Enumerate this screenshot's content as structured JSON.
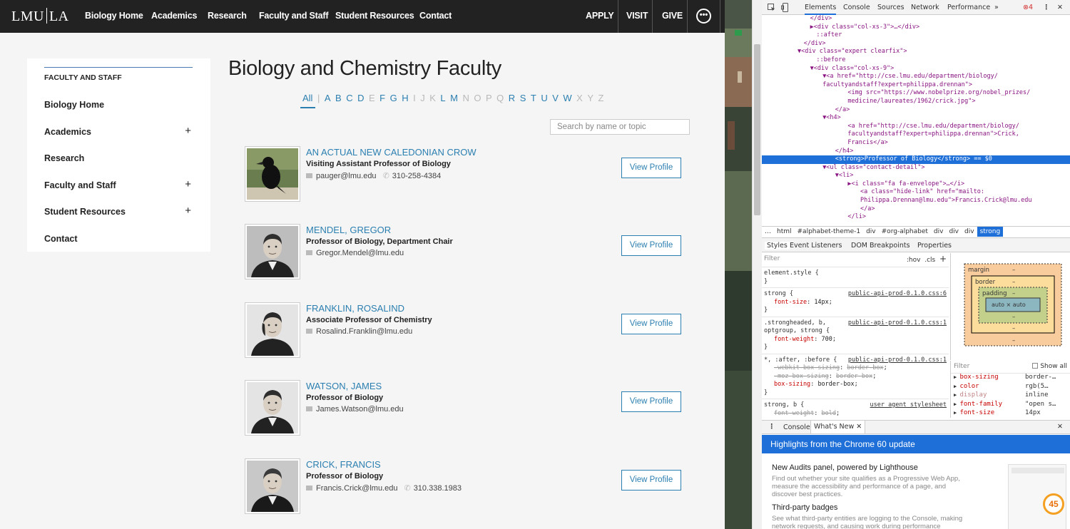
{
  "site": {
    "logo": {
      "left": "LMU",
      "right": "LA"
    },
    "nav": [
      "Biology Home",
      "Academics",
      "Research",
      "Faculty and Staff",
      "Student Resources",
      "Contact"
    ],
    "nav_right": [
      "APPLY",
      "VISIT",
      "GIVE"
    ],
    "more_icon": "ellipsis-circle-icon",
    "search_icon": "magnifier-icon",
    "sidebar": {
      "heading": "FACULTY AND STAFF",
      "items": [
        {
          "label": "Biology Home",
          "expandable": false
        },
        {
          "label": "Academics",
          "expandable": true
        },
        {
          "label": "Research",
          "expandable": false
        },
        {
          "label": "Faculty and Staff",
          "expandable": true
        },
        {
          "label": "Student Resources",
          "expandable": true
        },
        {
          "label": "Contact",
          "expandable": false
        }
      ],
      "plus": "+"
    },
    "page_title": "Biology and Chemistry Faculty",
    "alphabet": {
      "all": "All",
      "sep": "|",
      "letters": [
        {
          "l": "A",
          "a": true
        },
        {
          "l": "B",
          "a": true
        },
        {
          "l": "C",
          "a": true
        },
        {
          "l": "D",
          "a": true
        },
        {
          "l": "E",
          "a": false
        },
        {
          "l": "F",
          "a": true
        },
        {
          "l": "G",
          "a": true
        },
        {
          "l": "H",
          "a": true
        },
        {
          "l": "I",
          "a": false
        },
        {
          "l": "J",
          "a": false
        },
        {
          "l": "K",
          "a": false
        },
        {
          "l": "L",
          "a": true
        },
        {
          "l": "M",
          "a": true
        },
        {
          "l": "N",
          "a": false
        },
        {
          "l": "O",
          "a": false
        },
        {
          "l": "P",
          "a": false
        },
        {
          "l": "Q",
          "a": false
        },
        {
          "l": "R",
          "a": true
        },
        {
          "l": "S",
          "a": true
        },
        {
          "l": "T",
          "a": true
        },
        {
          "l": "U",
          "a": true
        },
        {
          "l": "V",
          "a": true
        },
        {
          "l": "W",
          "a": true
        },
        {
          "l": "X",
          "a": false
        },
        {
          "l": "Y",
          "a": false
        },
        {
          "l": "Z",
          "a": false
        }
      ]
    },
    "search_placeholder": "Search by name or topic",
    "view_profile": "View Profile",
    "faculty": [
      {
        "name": "AN ACTUAL NEW CALEDONIAN CROW",
        "title": "Visiting Assistant Professor of Biology",
        "email": "pauger@lmu.edu",
        "phone": "310-258-4384",
        "photo": "crow-photo"
      },
      {
        "name": "MENDEL, GREGOR",
        "title": "Professor of Biology, Department Chair",
        "email": "Gregor.Mendel@lmu.edu",
        "phone": "",
        "photo": "mendel-photo"
      },
      {
        "name": "FRANKLIN, ROSALIND",
        "title": "Associate Professor of Chemistry",
        "email": "Rosalind.Franklin@lmu.edu",
        "phone": "",
        "photo": "franklin-photo"
      },
      {
        "name": "WATSON, JAMES",
        "title": "Professor of Biology",
        "email": "James.Watson@lmu.edu",
        "phone": "",
        "photo": "watson-photo"
      },
      {
        "name": "CRICK, FRANCIS",
        "title": "Professor of Biology",
        "email": "Francis.Crick@lmu.edu",
        "phone": "310.338.1983",
        "photo": "crick-photo"
      }
    ]
  },
  "devtools": {
    "tabs": [
      "Elements",
      "Console",
      "Sources",
      "Network",
      "Performance",
      "»"
    ],
    "active_tab": "Elements",
    "error_count": "4",
    "dom_lines": [
      {
        "i": 14,
        "t": "</div>"
      },
      {
        "i": 14,
        "t": "▶<div class=\"col-xs-3\">…</div>"
      },
      {
        "i": 16,
        "t": "::after"
      },
      {
        "i": 12,
        "t": "</div>"
      },
      {
        "i": 10,
        "t": "▼<div class=\"expert clearfix\">"
      },
      {
        "i": 16,
        "t": "::before"
      },
      {
        "i": 14,
        "t": "▼<div class=\"col-xs-9\">"
      },
      {
        "i": 18,
        "t": "▼<a href=\"http://cse.lmu.edu/department/biology/"
      },
      {
        "i": 18,
        "t": "facultyandstaff?expert=philippa.drennan\">"
      },
      {
        "i": 26,
        "t": "<img src=\"https://www.nobelprize.org/nobel_prizes/"
      },
      {
        "i": 26,
        "t": "medicine/laureates/1962/crick.jpg\">"
      },
      {
        "i": 22,
        "t": "</a>"
      },
      {
        "i": 18,
        "t": "▼<h4>"
      },
      {
        "i": 26,
        "t": "<a href=\"http://cse.lmu.edu/department/biology/"
      },
      {
        "i": 26,
        "t": "facultyandstaff?expert=philippa.drennan\">Crick,"
      },
      {
        "i": 26,
        "t": "Francis</a>"
      },
      {
        "i": 22,
        "t": "</h4>"
      },
      {
        "i": 22,
        "t": "<strong>Professor of Biology</strong> == $0",
        "sel": true
      },
      {
        "i": 18,
        "t": "▼<ul class=\"contact-detail\">"
      },
      {
        "i": 22,
        "t": "▼<li>"
      },
      {
        "i": 26,
        "t": "▶<i class=\"fa fa-envelope\">…</i>"
      },
      {
        "i": 30,
        "t": "<a class=\"hide-link\" href=\"mailto:"
      },
      {
        "i": 30,
        "t": "Philippa.Drennan@lmu.edu\">Francis.Crick@lmu.edu"
      },
      {
        "i": 30,
        "t": "</a>"
      },
      {
        "i": 26,
        "t": "</li>"
      }
    ],
    "crumbs": [
      "…",
      "html",
      "#alphabet-theme-1",
      "div",
      "#org-alphabet",
      "div",
      "div",
      "div",
      "strong"
    ],
    "style_tabs": [
      "Styles",
      "Event Listeners",
      "DOM Breakpoints",
      "Properties"
    ],
    "filter": "Filter",
    "hov": ":hov",
    "cls": ".cls",
    "rules": [
      {
        "sel": "element.style {",
        "src": "",
        "props": []
      },
      {
        "sel": "strong {",
        "src": "public-api-prod-0.1.0.css:6",
        "props": [
          {
            "p": "font-size",
            "v": "14px",
            "s": false
          }
        ]
      },
      {
        "sel": ".strongheaded, b, optgroup, strong {",
        "src": "public-api-prod-0.1.0.css:1",
        "props": [
          {
            "p": "font-weight",
            "v": "700",
            "s": false
          }
        ]
      },
      {
        "sel": "*, :after, :before {",
        "src": "public-api-prod-0.1.0.css:1",
        "props": [
          {
            "p": "-webkit-box-sizing",
            "v": "border-box",
            "s": true
          },
          {
            "p": "-moz-box-sizing",
            "v": "border-box",
            "s": true
          },
          {
            "p": "box-sizing",
            "v": "border-box",
            "s": false
          }
        ]
      },
      {
        "sel": "strong, b {",
        "src": "user agent stylesheet",
        "props": [
          {
            "p": "font-weight",
            "v": "bold",
            "s": true
          }
        ]
      }
    ],
    "boxmodel": {
      "margin": "margin",
      "border": "border",
      "padding": "padding",
      "content": "auto × auto",
      "dash": "–"
    },
    "computed_filter": "Filter",
    "show_all": "Show all",
    "computed": [
      {
        "p": "box-sizing",
        "v": "border-…"
      },
      {
        "p": "color",
        "v": "rgb(5…"
      },
      {
        "p": "display",
        "v": "inline"
      },
      {
        "p": "font-family",
        "v": "\"open s…"
      },
      {
        "p": "font-size",
        "v": "14px"
      }
    ],
    "drawer_tabs": [
      "Console",
      "What's New"
    ],
    "highlights": "Highlights from the Chrome 60 update",
    "whatsnew": [
      {
        "h": "New Audits panel, powered by Lighthouse",
        "p": "Find out whether your site qualifies as a Progressive Web App, measure the accessibility and performance of a page, and discover best practices."
      },
      {
        "h": "Third-party badges",
        "p": "See what third-party entities are logging to the Console, making network requests, and causing work during performance"
      }
    ],
    "thumb_score": "45"
  }
}
